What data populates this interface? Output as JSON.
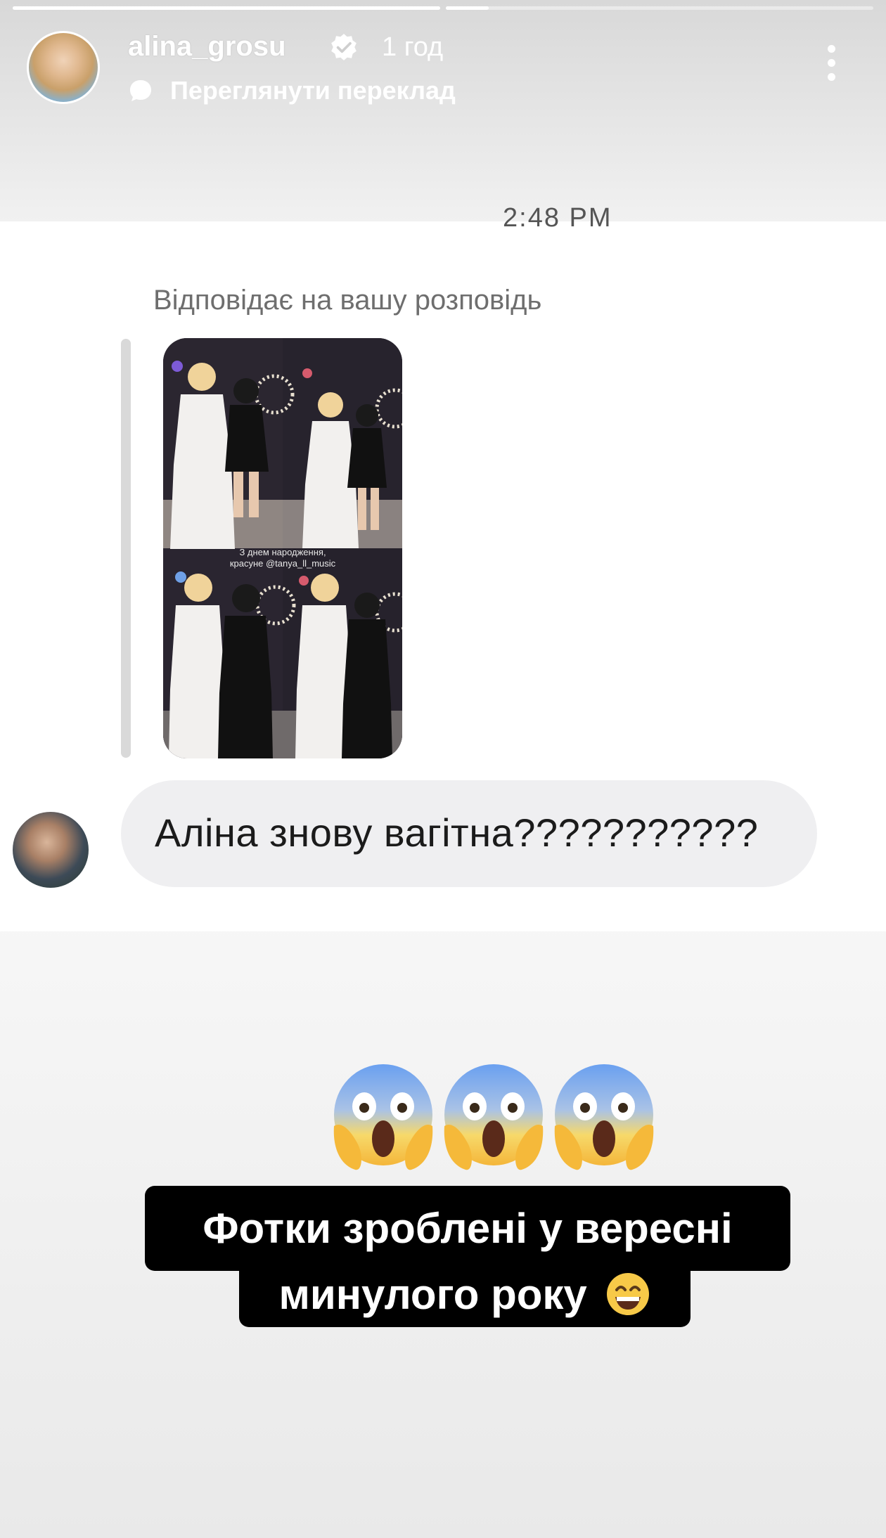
{
  "story": {
    "progress_segments": [
      1.0,
      0.1
    ],
    "username": "alina_grosu",
    "time_ago": "1 год",
    "translate_label": "Переглянути переклад",
    "icons": {
      "verified": "verified-badge-icon",
      "translate": "translate-icon",
      "more": "more-options-icon"
    }
  },
  "chat": {
    "timestamp_partial": "2:48 PM",
    "reply_label": "Відповідає на вашу розповідь",
    "story_thumbnail_caption_line1": "З днем народження,",
    "story_thumbnail_caption_line2": "красуне @tanya_ll_music",
    "message_text": "Аліна знову вагітна???????????"
  },
  "overlay": {
    "emojis": [
      "face-screaming-in-fear",
      "face-screaming-in-fear",
      "face-screaming-in-fear"
    ],
    "caption_line1": "Фотки зроблені у вересні",
    "caption_line2": "минулого року",
    "caption_emoji": "grinning-face"
  },
  "colors": {
    "header_text": "#ffffff",
    "bubble_bg": "#efeff1",
    "caption_bg": "#000000",
    "reply_label": "#6e6e6e"
  }
}
